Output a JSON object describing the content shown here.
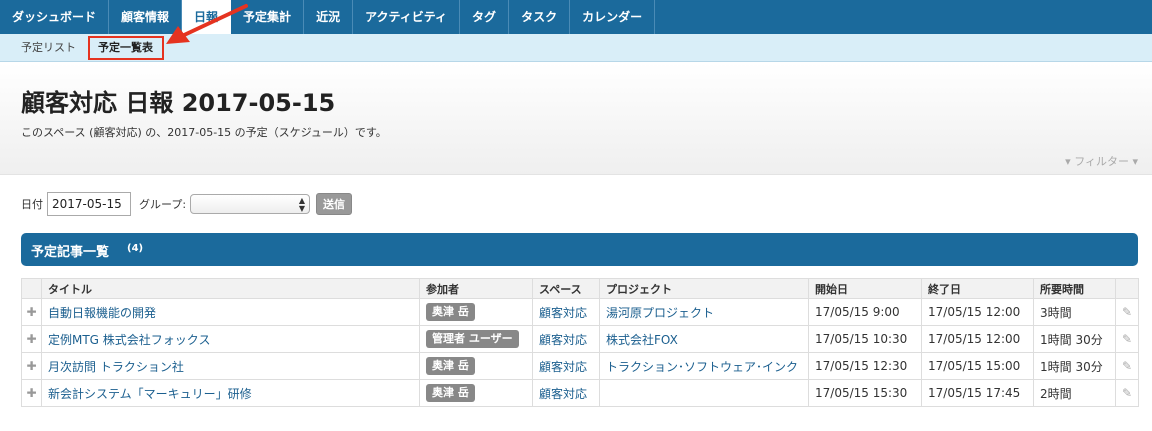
{
  "nav": {
    "items": [
      "ダッシュボード",
      "顧客情報",
      "日報",
      "予定集計",
      "近況",
      "アクティビティ",
      "タグ",
      "タスク",
      "カレンダー"
    ],
    "active": "日報"
  },
  "subnav": {
    "items": [
      "予定リスト",
      "予定一覧表"
    ],
    "current": "予定一覧表"
  },
  "header": {
    "title": "顧客対応 日報 2017-05-15",
    "description": "このスペース (顧客対応) の、2017-05-15 の予定（スケジュール）です。",
    "filter": "フィルター"
  },
  "form": {
    "date_label": "日付",
    "date_value": "2017-05-15",
    "group_label": "グループ:",
    "group_value": "",
    "submit_label": "送信"
  },
  "section": {
    "title": "予定記事一覧",
    "count": "(4)"
  },
  "table": {
    "headers": [
      "タイトル",
      "参加者",
      "スペース",
      "プロジェクト",
      "開始日",
      "終了日",
      "所要時間"
    ],
    "rows": [
      {
        "title": "自動日報機能の開発",
        "participant": "奥津 岳",
        "space": "顧客対応",
        "project": "湯河原プロジェクト",
        "start": "17/05/15 9:00",
        "end": "17/05/15 12:00",
        "duration": "3時間"
      },
      {
        "title": "定例MTG 株式会社フォックス",
        "participant": "管理者 ユーザー",
        "space": "顧客対応",
        "project": "株式会社FOX",
        "start": "17/05/15 10:30",
        "end": "17/05/15 12:00",
        "duration": "1時間 30分"
      },
      {
        "title": "月次訪問 トラクション社",
        "participant": "奥津 岳",
        "space": "顧客対応",
        "project": "トラクション･ソフトウェア･インク",
        "start": "17/05/15 12:30",
        "end": "17/05/15 15:00",
        "duration": "1時間 30分"
      },
      {
        "title": "新会計システム「マーキュリー」研修",
        "participant": "奥津 岳",
        "space": "顧客対応",
        "project": "",
        "start": "17/05/15 15:30",
        "end": "17/05/15 17:45",
        "duration": "2時間"
      }
    ]
  },
  "colors": {
    "nav_bg": "#1b6a9c",
    "subnav_bg": "#d9eef8",
    "highlight": "#e53320",
    "link": "#1b5f8f"
  }
}
